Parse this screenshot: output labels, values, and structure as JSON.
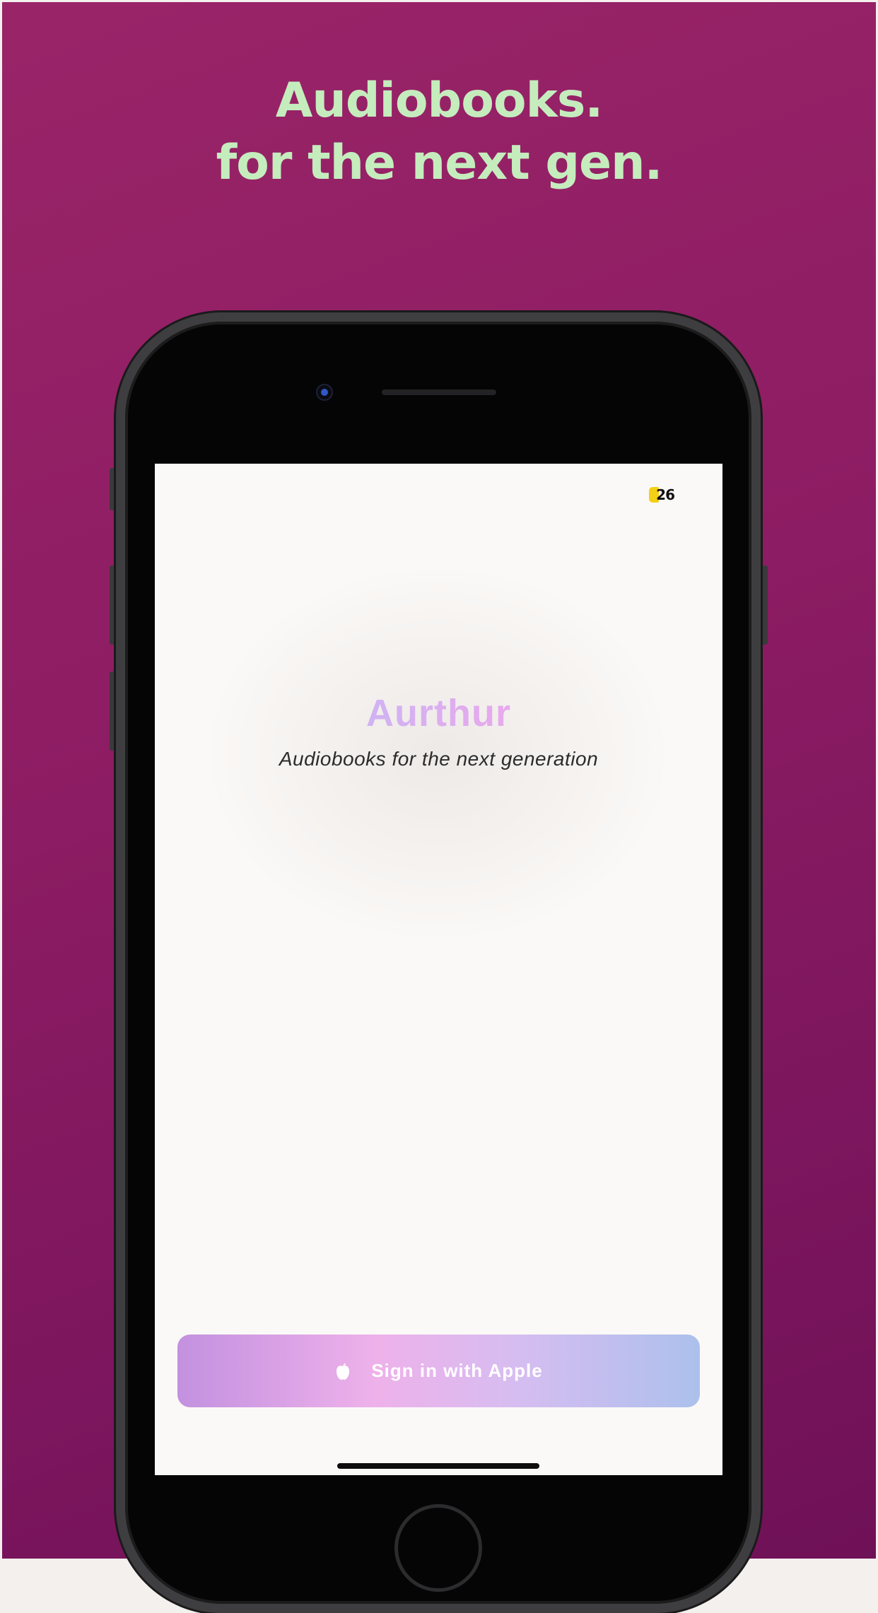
{
  "headline": {
    "line1": "Audiobooks.",
    "line2": "for the next gen."
  },
  "colors": {
    "background": "#8c1c63",
    "headline_text": "#c5ecbd",
    "screen_bg": "#fbf9f7",
    "app_name_gradient_start": "#c8b6f5",
    "app_name_gradient_end": "#f0a6ea",
    "button_gradient": [
      "#c391e0",
      "#eeb1ea",
      "#d6bdf1",
      "#acc0ec"
    ],
    "status_badge": "#f4cf17"
  },
  "phone": {
    "status": {
      "badge_text": "26"
    },
    "app": {
      "name": "Aurthur",
      "tagline": "Audiobooks for the next generation",
      "sign_in_button": {
        "label": "Sign in with Apple",
        "icon": "apple-icon"
      }
    }
  }
}
